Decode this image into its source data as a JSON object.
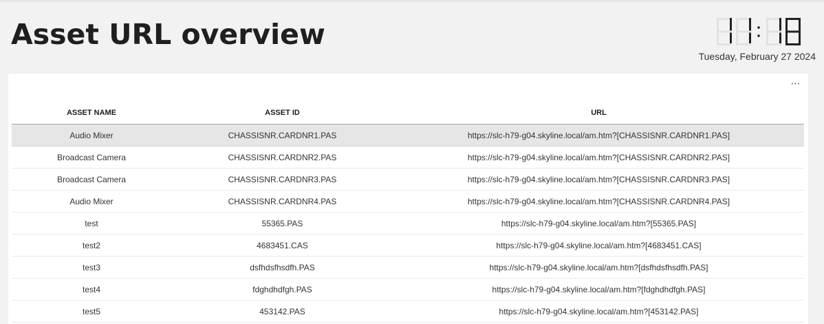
{
  "header": {
    "title": "Asset URL overview"
  },
  "clock": {
    "time": "11:18",
    "date": "Tuesday, February 27 2024"
  },
  "panel": {
    "more_label": "⋯"
  },
  "table": {
    "columns": [
      "ASSET NAME",
      "ASSET ID",
      "URL"
    ],
    "selected_row": 0,
    "rows": [
      {
        "name": "Audio Mixer",
        "id": "CHASSISNR.CARDNR1.PAS",
        "url": "https://slc-h79-g04.skyline.local/am.htm?[CHASSISNR.CARDNR1.PAS]"
      },
      {
        "name": "Broadcast Camera",
        "id": "CHASSISNR.CARDNR2.PAS",
        "url": "https://slc-h79-g04.skyline.local/am.htm?[CHASSISNR.CARDNR2.PAS]"
      },
      {
        "name": "Broadcast Camera",
        "id": "CHASSISNR.CARDNR3.PAS",
        "url": "https://slc-h79-g04.skyline.local/am.htm?[CHASSISNR.CARDNR3.PAS]"
      },
      {
        "name": "Audio Mixer",
        "id": "CHASSISNR.CARDNR4.PAS",
        "url": "https://slc-h79-g04.skyline.local/am.htm?[CHASSISNR.CARDNR4.PAS]"
      },
      {
        "name": "test",
        "id": "55365.PAS",
        "url": "https://slc-h79-g04.skyline.local/am.htm?[55365.PAS]"
      },
      {
        "name": "test2",
        "id": "4683451.CAS",
        "url": "https://slc-h79-g04.skyline.local/am.htm?[4683451.CAS]"
      },
      {
        "name": "test3",
        "id": "dsfhdsfhsdfh.PAS",
        "url": "https://slc-h79-g04.skyline.local/am.htm?[dsfhdsfhsdfh.PAS]"
      },
      {
        "name": "test4",
        "id": "fdghdhdfgh.PAS",
        "url": "https://slc-h79-g04.skyline.local/am.htm?[fdghdhdfgh.PAS]"
      },
      {
        "name": "test5",
        "id": "453142.PAS",
        "url": "https://slc-h79-g04.skyline.local/am.htm?[453142.PAS]"
      }
    ]
  },
  "colors": {
    "background": "#f2f2f2",
    "panel": "#ffffff",
    "selected_row": "#e6e6e6",
    "text": "#333333"
  }
}
